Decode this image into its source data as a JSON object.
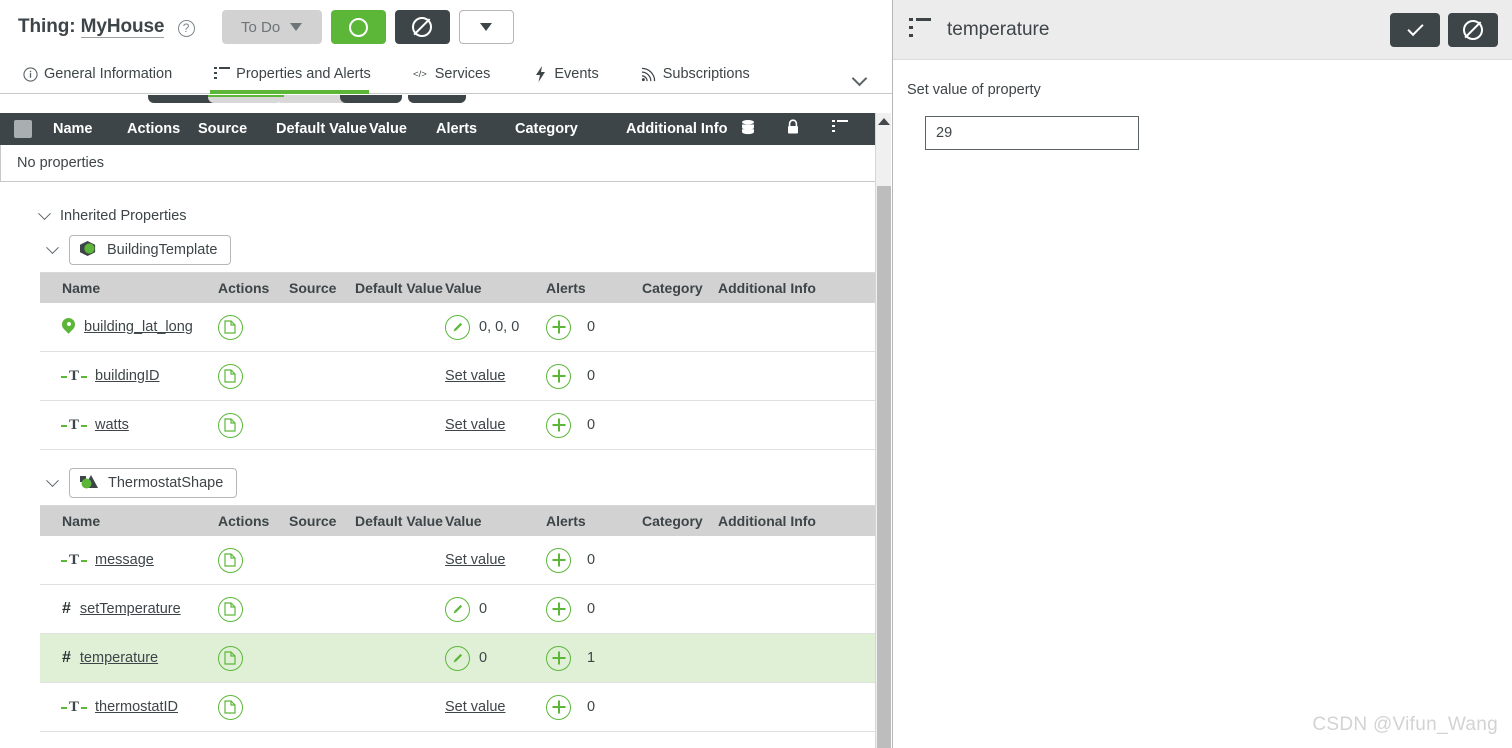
{
  "left": {
    "title_prefix": "Thing:",
    "title_name": "MyHouse",
    "help_icon": "question-circle-icon",
    "toolbar": {
      "todo_label": "To Do",
      "save_icon": "ring-icon",
      "cancel_icon": "deny-icon",
      "more_icon": "caret-down-icon"
    },
    "tabs": [
      {
        "label": "General Information",
        "icon": "info-icon",
        "active": false
      },
      {
        "label": "Properties and Alerts",
        "icon": "list-icon",
        "active": true
      },
      {
        "label": "Services",
        "icon": "code-icon",
        "active": false
      },
      {
        "label": "Events",
        "icon": "bolt-icon",
        "active": false
      },
      {
        "label": "Subscriptions",
        "icon": "signal-icon",
        "active": false
      }
    ],
    "main_table": {
      "columns": [
        "Name",
        "Actions",
        "Source",
        "Default Value",
        "Value",
        "Alerts",
        "Category",
        "Additional Info"
      ],
      "icon_columns": [
        "database-icon",
        "lock-icon",
        "list-icon"
      ],
      "empty_text": "No properties"
    },
    "inherited": {
      "label": "Inherited Properties",
      "groups": [
        {
          "name": "BuildingTemplate",
          "icon": "thing-template-icon",
          "columns": [
            "Name",
            "Actions",
            "Source",
            "Default Value",
            "Value",
            "Alerts",
            "Category",
            "Additional Info"
          ],
          "rows": [
            {
              "name": "building_lat_long",
              "type_icon": "location-icon",
              "action_icon": "copy-icon",
              "source": "",
              "default": "",
              "value": "0, 0, 0",
              "value_mode": "edit",
              "alerts": "0",
              "category": "",
              "additional": "",
              "highlight": false
            },
            {
              "name": "buildingID",
              "type_icon": "string-icon",
              "action_icon": "copy-icon",
              "source": "",
              "default": "",
              "value": "Set value",
              "value_mode": "link",
              "alerts": "0",
              "category": "",
              "additional": "",
              "highlight": false
            },
            {
              "name": "watts",
              "type_icon": "string-icon",
              "action_icon": "copy-icon",
              "source": "",
              "default": "",
              "value": "Set value",
              "value_mode": "link",
              "alerts": "0",
              "category": "",
              "additional": "",
              "highlight": false
            }
          ]
        },
        {
          "name": "ThermostatShape",
          "icon": "thing-shape-icon",
          "columns": [
            "Name",
            "Actions",
            "Source",
            "Default Value",
            "Value",
            "Alerts",
            "Category",
            "Additional Info"
          ],
          "rows": [
            {
              "name": "message",
              "type_icon": "string-icon",
              "action_icon": "copy-icon",
              "source": "",
              "default": "",
              "value": "Set value",
              "value_mode": "link",
              "alerts": "0",
              "category": "",
              "additional": "",
              "highlight": false
            },
            {
              "name": "setTemperature",
              "type_icon": "number-icon",
              "action_icon": "copy-icon",
              "source": "",
              "default": "",
              "value": "0",
              "value_mode": "edit",
              "alerts": "0",
              "category": "",
              "additional": "",
              "highlight": false
            },
            {
              "name": "temperature",
              "type_icon": "number-icon",
              "action_icon": "copy-icon",
              "source": "",
              "default": "",
              "value": "0",
              "value_mode": "edit",
              "alerts": "1",
              "category": "",
              "additional": "",
              "highlight": true
            },
            {
              "name": "thermostatID",
              "type_icon": "string-icon",
              "action_icon": "copy-icon",
              "source": "",
              "default": "",
              "value": "Set value",
              "value_mode": "link",
              "alerts": "0",
              "category": "",
              "additional": "",
              "highlight": false
            }
          ]
        }
      ]
    }
  },
  "right": {
    "title": "temperature",
    "title_icon": "list-icon",
    "confirm_icon": "check-icon",
    "cancel_icon": "deny-icon",
    "form_label": "Set value of property",
    "input_value": "29"
  },
  "watermark": "CSDN @Vifun_Wang",
  "colors": {
    "accent_green": "#5cb739",
    "dark": "#3d4548",
    "highlight_row": "#dff0d7",
    "header_gray": "#d2d2d2"
  }
}
